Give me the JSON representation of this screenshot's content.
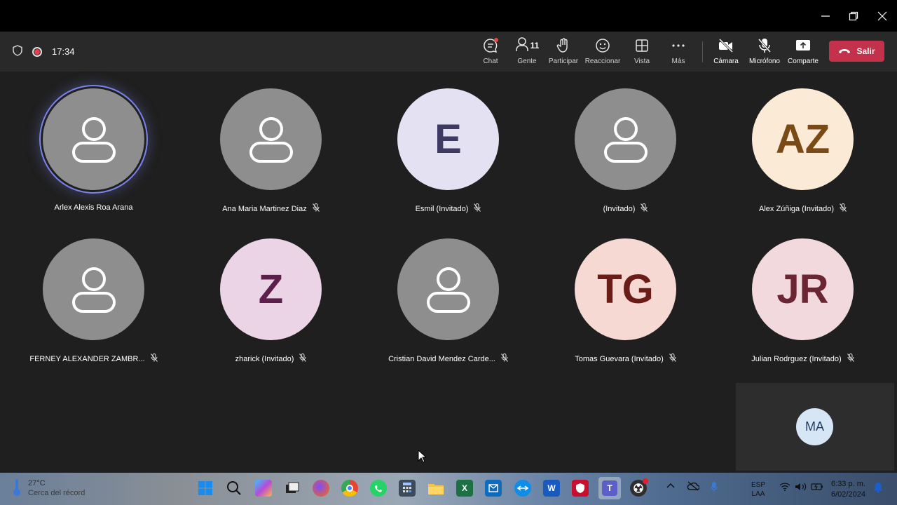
{
  "toolbar": {
    "timer": "17:34",
    "buttons": [
      {
        "label": "Chat",
        "icon": "chat-icon"
      },
      {
        "label": "Gente",
        "icon": "people-icon",
        "count": "11"
      },
      {
        "label": "Participar",
        "icon": "raise-hand-icon"
      },
      {
        "label": "Reaccionar",
        "icon": "emoji-icon"
      },
      {
        "label": "Vista",
        "icon": "grid-view-icon"
      },
      {
        "label": "Más",
        "icon": "more-icon"
      },
      {
        "label": "Cámara",
        "icon": "camera-off-icon"
      },
      {
        "label": "Micrófono",
        "icon": "mic-off-icon"
      },
      {
        "label": "Comparte",
        "icon": "share-icon"
      }
    ],
    "leave_label": "Salir"
  },
  "participants": [
    {
      "name": "Arlex Alexis Roa Arana",
      "initials": "",
      "bg": "#8e8e8e",
      "fg": "#ffffff",
      "muted": false,
      "speaking": true
    },
    {
      "name": "Ana Maria Martinez Diaz",
      "initials": "",
      "bg": "#8e8e8e",
      "fg": "#ffffff",
      "muted": true
    },
    {
      "name": "Esmil (Invitado)",
      "initials": "E",
      "bg": "#e4e2f2",
      "fg": "#3e3a63",
      "muted": true
    },
    {
      "name": "(Invitado)",
      "initials": "",
      "bg": "#8e8e8e",
      "fg": "#ffffff",
      "muted": true
    },
    {
      "name": "Alex Zúñiga (Invitado)",
      "initials": "AZ",
      "bg": "#fbebd6",
      "fg": "#7a4a16",
      "muted": true
    },
    {
      "name": "FERNEY ALEXANDER ZAMBR...",
      "initials": "",
      "bg": "#8e8e8e",
      "fg": "#ffffff",
      "muted": true
    },
    {
      "name": "zharick (Invitado)",
      "initials": "Z",
      "bg": "#ebd4e6",
      "fg": "#5a1f4a",
      "muted": true
    },
    {
      "name": "Cristian David Mendez Carde...",
      "initials": "",
      "bg": "#8e8e8e",
      "fg": "#ffffff",
      "muted": true
    },
    {
      "name": "Tomas Guevara (Invitado)",
      "initials": "TG",
      "bg": "#f7d9d4",
      "fg": "#6a1d17",
      "muted": true
    },
    {
      "name": "Julian Rodrguez (Invitado)",
      "initials": "JR",
      "bg": "#f2d9de",
      "fg": "#6b2634",
      "muted": true
    }
  ],
  "self_view": {
    "initials": "MA"
  },
  "taskbar": {
    "weather_temp": "27°C",
    "weather_desc": "Cerca del récord",
    "lang_top": "ESP",
    "lang_bottom": "LAA",
    "time": "6:33 p. m.",
    "date": "6/02/2024",
    "apps": [
      "start-icon",
      "search-icon",
      "copilot-icon",
      "task-view-icon",
      "firefox-icon",
      "chrome-icon",
      "whatsapp-icon",
      "calculator-icon",
      "file-explorer-icon",
      "excel-icon",
      "outlook-icon",
      "teamviewer-icon",
      "word-icon",
      "mcafee-icon",
      "teams-icon",
      "obs-icon"
    ]
  }
}
